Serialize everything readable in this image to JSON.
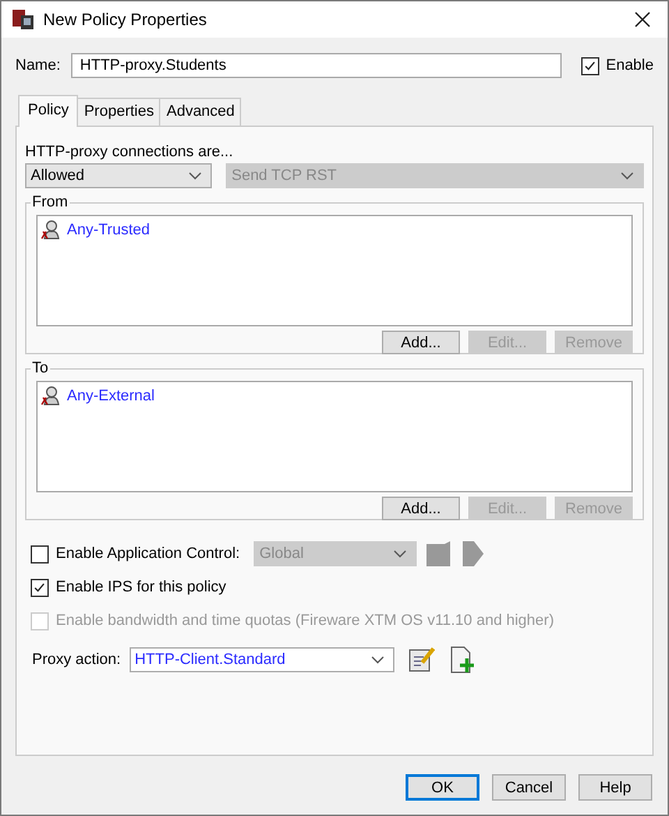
{
  "window": {
    "title": "New Policy Properties"
  },
  "name_field": {
    "label": "Name:",
    "value": "HTTP-proxy.Students"
  },
  "enable": {
    "label": "Enable",
    "checked": true
  },
  "tabs": [
    {
      "label": "Policy",
      "selected": true
    },
    {
      "label": "Properties",
      "selected": false
    },
    {
      "label": "Advanced",
      "selected": false
    }
  ],
  "connections": {
    "label": "HTTP-proxy connections are...",
    "action": {
      "value": "Allowed",
      "disabled": false
    },
    "response": {
      "value": "Send TCP RST",
      "disabled": true
    }
  },
  "groups": [
    {
      "title": "From",
      "items": [
        {
          "text": "Any-Trusted"
        }
      ],
      "buttons": [
        {
          "label": "Add...",
          "disabled": false
        },
        {
          "label": "Edit...",
          "disabled": true
        },
        {
          "label": "Remove",
          "disabled": true
        }
      ]
    },
    {
      "title": "To",
      "items": [
        {
          "text": "Any-External"
        }
      ],
      "buttons": [
        {
          "label": "Add...",
          "disabled": false
        },
        {
          "label": "Edit...",
          "disabled": true
        },
        {
          "label": "Remove",
          "disabled": true
        }
      ]
    }
  ],
  "options": [
    {
      "kind": "dropdown",
      "label": "Enable Application Control:",
      "checked": false,
      "disabled": false,
      "value": "Global",
      "value_disabled": true
    },
    {
      "kind": "checkbox",
      "label": "Enable IPS for this policy",
      "checked": true,
      "disabled": false
    },
    {
      "kind": "checkbox",
      "label": "Enable bandwidth and time quotas (Fireware XTM OS v11.10 and higher)",
      "checked": false,
      "disabled": true
    }
  ],
  "proxy_action": {
    "label": "Proxy action:",
    "value": "HTTP-Client.Standard"
  },
  "buttons": [
    {
      "label": "OK",
      "default": true
    },
    {
      "label": "Cancel",
      "default": false
    },
    {
      "label": "Help",
      "default": false
    }
  ]
}
